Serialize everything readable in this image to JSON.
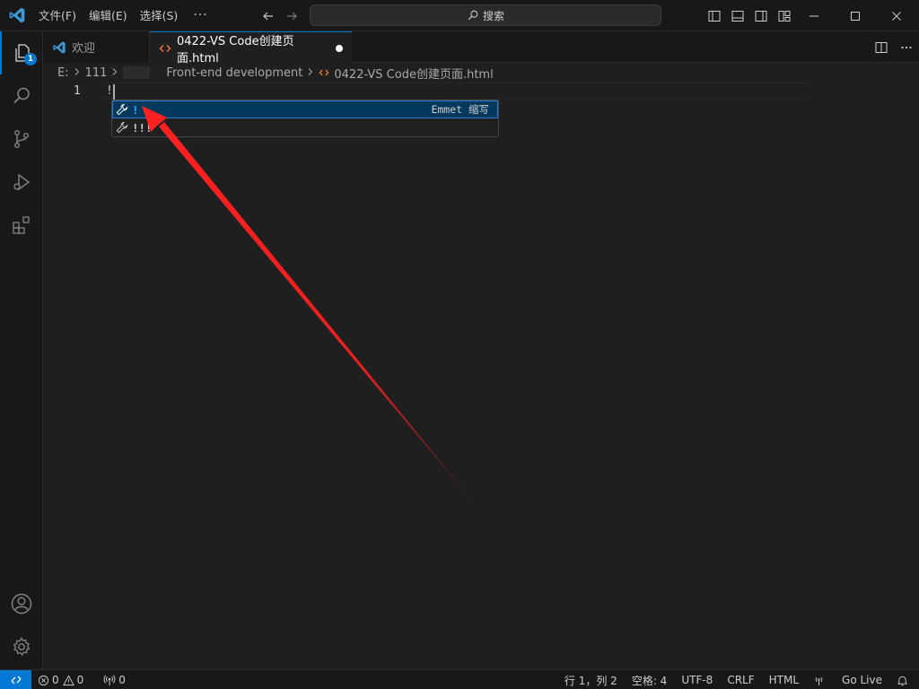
{
  "titlebar": {
    "menu": [
      "文件(F)",
      "编辑(E)",
      "选择(S)"
    ],
    "more": "···",
    "search_label": "搜索"
  },
  "activity": {
    "explorer_badge": "1"
  },
  "tabs": [
    {
      "label": "欢迎",
      "icon": "vscode-logo-icon"
    },
    {
      "label": "0422-VS Code创建页面.html",
      "icon": "html-file-icon",
      "modified": true
    }
  ],
  "breadcrumb": {
    "parts": [
      "E:",
      "111",
      "Front-end development",
      "0422-VS Code创建页面.html"
    ]
  },
  "editor": {
    "line_number": "1",
    "line_text": "!"
  },
  "suggest": {
    "items": [
      {
        "label": "!",
        "detail": "Emmet 缩写",
        "selected": true
      },
      {
        "label": "!!!",
        "detail": "",
        "selected": false
      }
    ]
  },
  "statusbar": {
    "errors": "0",
    "warnings": "0",
    "ports": "0",
    "position": "行 1，列 2",
    "spaces": "空格: 4",
    "encoding": "UTF-8",
    "eol": "CRLF",
    "language": "HTML",
    "golive": "Go Live"
  },
  "colors": {
    "accent": "#0078d4",
    "annotation_arrow": "#ff2020",
    "html_icon": "#e37933"
  }
}
